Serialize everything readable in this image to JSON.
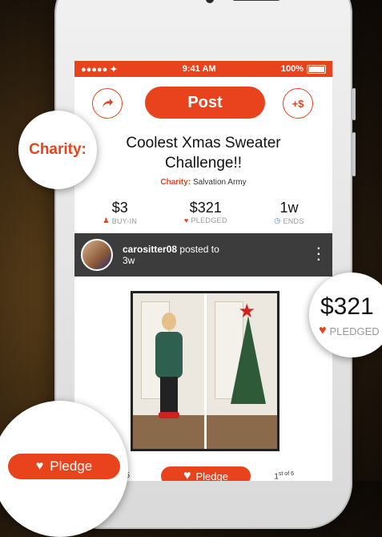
{
  "status_bar": {
    "carrier": "●●●●● ✦",
    "time": "9:41 AM",
    "battery": "100%"
  },
  "toolbar": {
    "share_icon": "share-arrow-icon",
    "post_label": "Post",
    "add_money_label": "+$"
  },
  "challenge": {
    "title_line1": "Coolest Xmas Sweater",
    "title_line2": "Challenge!!",
    "charity_label": "Charity:",
    "charity_name": "Salvation Army"
  },
  "stats": [
    {
      "value": "$3",
      "label": "BUY-IN",
      "icon": "person-icon"
    },
    {
      "value": "$321",
      "label": "PLEDGED",
      "icon": "heart-icon"
    },
    {
      "value": "1w",
      "label": "ENDS",
      "icon": "clock-icon"
    }
  ],
  "post": {
    "username": "carositter08",
    "action": "posted to",
    "time_ago": "3w"
  },
  "bottom": {
    "count": "65",
    "pledge_label": "Pledge",
    "pager_num": "1",
    "pager_sup": "st of 6"
  },
  "callouts": {
    "charity": "Charity:",
    "pledged_amount": "$321",
    "pledged_label": "PLEDGED",
    "pledge_button": "Pledge"
  },
  "colors": {
    "accent": "#e8431c",
    "blue": "#3b7fd0",
    "poster_bar": "#3c3c3c"
  }
}
